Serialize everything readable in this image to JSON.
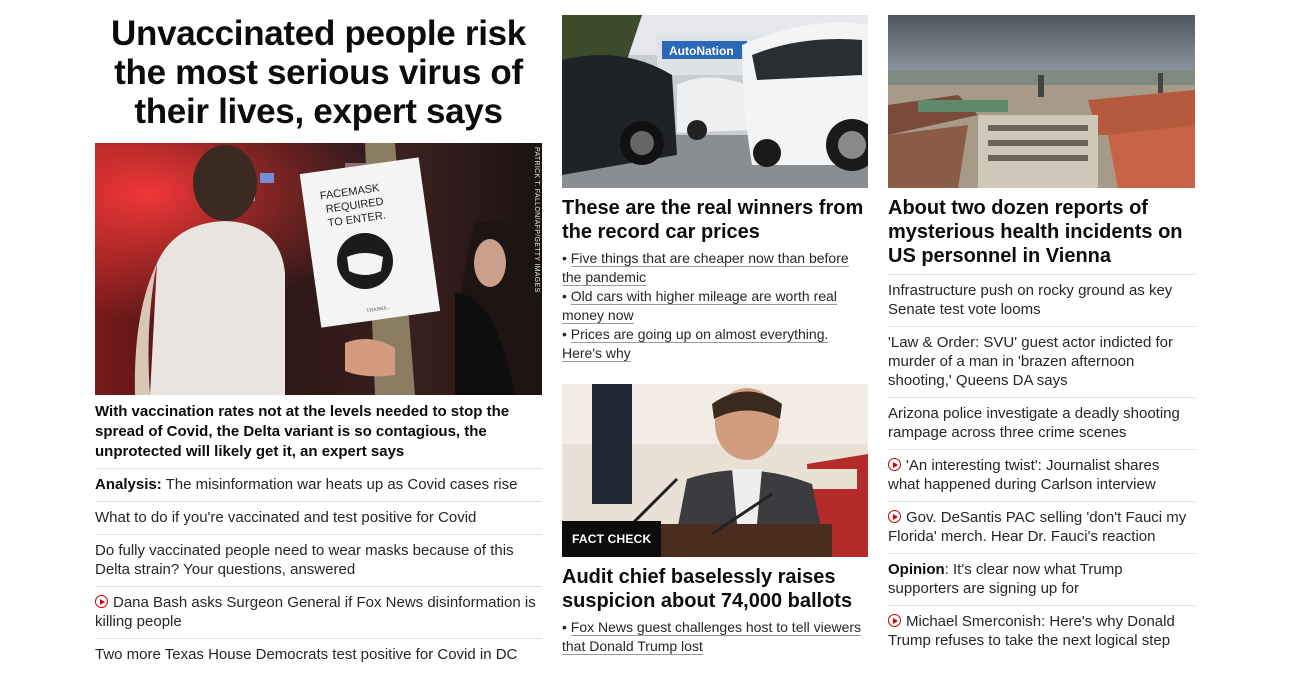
{
  "col1": {
    "title": "Unvaccinated people risk the most serious virus of their lives, expert says",
    "image": {
      "sign_line1": "FACEMASK",
      "sign_line2": "REQUIRED",
      "sign_line3": "TO ENTER.",
      "sign_foot": "THANKS...",
      "credit": "PATRICK T. FALLON/AFP/GETTY IMAGES"
    },
    "lede": "With vaccination rates not at the levels needed to stop the spread of Covid, the Delta variant is so contagious, the unprotected will likely get it, an expert says",
    "items": [
      {
        "prefix": "Analysis:",
        "text": " The misinformation war heats up as Covid cases rise"
      },
      {
        "text": "What to do if you're vaccinated and test positive for Covid"
      },
      {
        "text": "Do fully vaccinated people need to wear masks because of this Delta strain? Your questions, answered"
      },
      {
        "text": "Dana Bash asks Surgeon General if Fox News disinformation is killing people",
        "video": true
      },
      {
        "text": "Two more Texas House Democrats test positive for Covid in DC"
      }
    ]
  },
  "col2": {
    "card1": {
      "image": {
        "sign": "AutoNation"
      },
      "title": "These are the real winners from the record car prices",
      "bullets": [
        "Five things that are cheaper now than before the pandemic",
        "Old cars with higher mileage are worth real money now",
        "Prices are going up on almost everything. Here's why"
      ]
    },
    "card2": {
      "badge": "FACT CHECK",
      "title": "Audit chief baselessly raises suspicion about 74,000 ballots",
      "bullets": [
        "Fox News guest challenges host to tell viewers that Donald Trump lost"
      ]
    }
  },
  "col3": {
    "title": "About two dozen reports of mysterious health incidents on US personnel in Vienna",
    "items": [
      {
        "text": "Infrastructure push on rocky ground as key Senate test vote looms"
      },
      {
        "text": "'Law & Order: SVU' guest actor indicted for murder of a man in 'brazen afternoon shooting,' Queens DA says"
      },
      {
        "text": "Arizona police investigate a deadly shooting rampage across three crime scenes"
      },
      {
        "text": "'An interesting twist': Journalist shares what happened during Carlson interview",
        "video": true
      },
      {
        "text": "Gov. DeSantis PAC selling 'don't Fauci my Florida' merch. Hear Dr. Fauci's reaction",
        "video": true
      },
      {
        "prefix": "Opinion",
        "text": ": It's clear now what Trump supporters are signing up for"
      },
      {
        "text": "Michael Smerconish: Here's why Donald Trump refuses to take the next logical step",
        "video": true
      }
    ]
  },
  "colors": {
    "accent_red": "#cc0000",
    "badge_bg": "#0c0c0c",
    "divider": "#e0e0e0"
  }
}
